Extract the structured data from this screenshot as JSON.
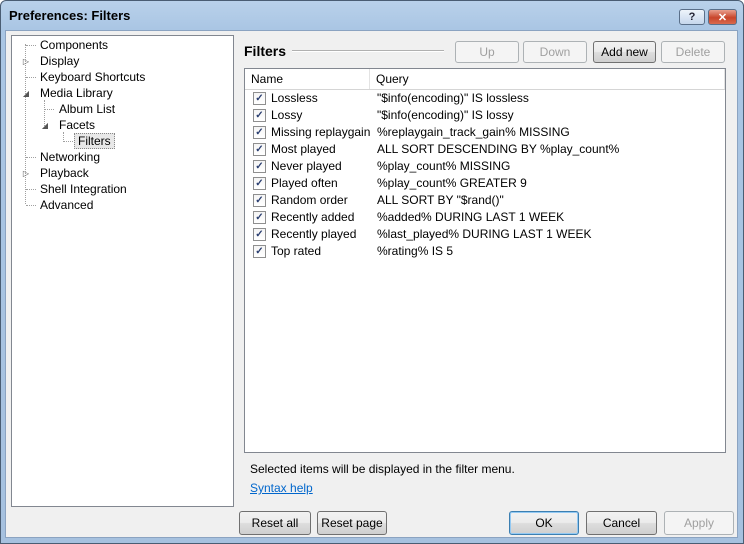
{
  "window": {
    "title": "Preferences: Filters",
    "help_glyph": "?",
    "close_glyph": "✕"
  },
  "tree": {
    "items": [
      {
        "label": "Components"
      },
      {
        "label": "Display",
        "expander": "▷"
      },
      {
        "label": "Keyboard Shortcuts"
      },
      {
        "label": "Media Library",
        "expander": "◢"
      },
      {
        "label": "Album List"
      },
      {
        "label": "Facets",
        "expander": "◢"
      },
      {
        "label": "Filters"
      },
      {
        "label": "Networking"
      },
      {
        "label": "Playback",
        "expander": "▷"
      },
      {
        "label": "Shell Integration"
      },
      {
        "label": "Advanced"
      }
    ],
    "selected": "Filters"
  },
  "page": {
    "title": "Filters",
    "buttons": {
      "up": "Up",
      "down": "Down",
      "add_new": "Add new",
      "delete": "Delete"
    },
    "columns": {
      "name": "Name",
      "query": "Query"
    },
    "rows": [
      {
        "name": "Lossless",
        "query": "\"$info(encoding)\" IS lossless",
        "checked": true
      },
      {
        "name": "Lossy",
        "query": "\"$info(encoding)\" IS lossy",
        "checked": true
      },
      {
        "name": "Missing replaygain",
        "query": "%replaygain_track_gain% MISSING",
        "checked": true
      },
      {
        "name": "Most played",
        "query": "ALL SORT DESCENDING BY %play_count%",
        "checked": true
      },
      {
        "name": "Never played",
        "query": "%play_count% MISSING",
        "checked": true
      },
      {
        "name": "Played often",
        "query": "%play_count% GREATER 9",
        "checked": true
      },
      {
        "name": "Random order",
        "query": "ALL SORT BY \"$rand()\"",
        "checked": true
      },
      {
        "name": "Recently added",
        "query": "%added% DURING LAST 1 WEEK",
        "checked": true
      },
      {
        "name": "Recently played",
        "query": "%last_played% DURING LAST 1 WEEK",
        "checked": true
      },
      {
        "name": "Top rated",
        "query": "%rating% IS 5",
        "checked": true
      }
    ],
    "check_glyph": "✓",
    "info_text": "Selected items will be displayed in the filter menu.",
    "syntax_link": "Syntax help"
  },
  "footer": {
    "reset_all": "Reset all",
    "reset_page": "Reset page",
    "ok": "OK",
    "cancel": "Cancel",
    "apply": "Apply"
  }
}
